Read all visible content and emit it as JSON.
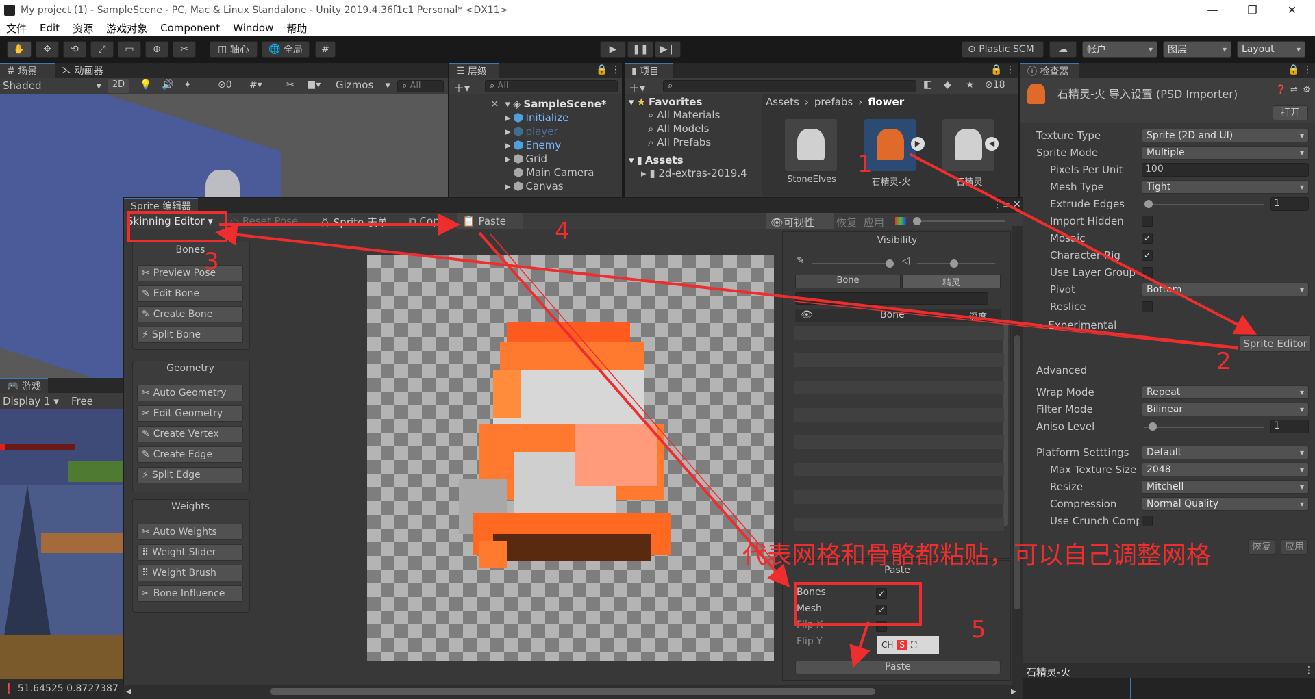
{
  "window": {
    "title": "My project (1) - SampleScene - PC, Mac & Linux Standalone - Unity 2019.4.36f1c1 Personal* <DX11>"
  },
  "menu": [
    "文件",
    "Edit",
    "资源",
    "游戏对象",
    "Component",
    "Window",
    "帮助"
  ],
  "toolbar": {
    "pivot_label": "轴心",
    "global_label": "全局",
    "plastic_label": "Plastic SCM",
    "account_label": "帐户",
    "layers_label": "图层",
    "layout_label": "Layout"
  },
  "scene": {
    "tab_scene": "场景",
    "tab_animator": "动画器",
    "shading": "Shaded",
    "mode_2d": "2D",
    "hidden_count": "0",
    "gizmos": "Gizmos",
    "search_placeholder": "All"
  },
  "game": {
    "tab": "游戏",
    "display": "Display 1",
    "aspect": "Free Aspect",
    "coords": "51.64525 0.8727387"
  },
  "hierarchy": {
    "tab": "层级",
    "search_placeholder": "All",
    "scene_name": "SampleScene*",
    "items": [
      "Initialize",
      "player",
      "Enemy",
      "Grid",
      "Main Camera",
      "Canvas"
    ]
  },
  "project": {
    "tab": "项目",
    "hidden_count": "18",
    "favorites_label": "Favorites",
    "favorites": [
      "All Materials",
      "All Models",
      "All Prefabs"
    ],
    "assets_label": "Assets",
    "asset_items": [
      "2d-extras-2019.4"
    ],
    "breadcrumb": [
      "Assets",
      "prefabs",
      "flower"
    ],
    "thumbs": [
      "StoneElves",
      "石精灵-火",
      "石精灵"
    ]
  },
  "inspector": {
    "tab": "检查器",
    "asset_title": "石精灵-火 导入设置 (PSD Importer)",
    "open_button": "打开",
    "fields": {
      "texture_type": {
        "label": "Texture Type",
        "value": "Sprite (2D and UI)"
      },
      "sprite_mode": {
        "label": "Sprite Mode",
        "value": "Multiple"
      },
      "ppu": {
        "label": "Pixels Per Unit",
        "value": "100"
      },
      "mesh_type": {
        "label": "Mesh Type",
        "value": "Tight"
      },
      "extrude": {
        "label": "Extrude Edges",
        "value": "1"
      },
      "import_hidden": {
        "label": "Import Hidden"
      },
      "mosaic": {
        "label": "Mosaic"
      },
      "character_rig": {
        "label": "Character Rig"
      },
      "use_layer_group": {
        "label": "Use Layer Group"
      },
      "pivot": {
        "label": "Pivot",
        "value": "Bottom"
      },
      "reslice": {
        "label": "Reslice"
      },
      "experimental": {
        "label": "Experimental"
      }
    },
    "sprite_editor_button": "Sprite Editor",
    "advanced_label": "Advanced",
    "wrap_mode": {
      "label": "Wrap Mode",
      "value": "Repeat"
    },
    "filter_mode": {
      "label": "Filter Mode",
      "value": "Bilinear"
    },
    "aniso": {
      "label": "Aniso Level",
      "value": "1"
    },
    "platform_label": "Platform Setttings",
    "platform_value": "Default",
    "max_size": {
      "label": "Max Texture Size",
      "value": "2048"
    },
    "resize": {
      "label": "Resize",
      "value": "Mitchell"
    },
    "compression": {
      "label": "Compression",
      "value": "Normal Quality"
    },
    "crunch": {
      "label": "Use Crunch Compression"
    },
    "revert_button": "恢复",
    "apply_button": "应用",
    "preview_title": "石精灵-火"
  },
  "sprite_editor": {
    "title": "Sprite 编辑器",
    "mode_dropdown": "Skinning Editor",
    "reset_pose": "Reset Pose",
    "sprite_list": "Sprite 表单",
    "copy": "Copy",
    "paste": "Paste",
    "visibility_toggle": "可视性",
    "revert": "恢复",
    "apply": "应用",
    "groups": {
      "bones": {
        "title": "Bones",
        "buttons": [
          "Preview Pose",
          "Edit Bone",
          "Create Bone",
          "Split Bone"
        ]
      },
      "geometry": {
        "title": "Geometry",
        "buttons": [
          "Auto Geometry",
          "Edit Geometry",
          "Create Vertex",
          "Create Edge",
          "Split Edge"
        ]
      },
      "weights": {
        "title": "Weights",
        "buttons": [
          "Auto Weights",
          "Weight Slider",
          "Weight Brush",
          "Bone Influence"
        ]
      }
    },
    "visibility": {
      "title": "Visibility",
      "tab_bone": "Bone",
      "tab_sprite": "精灵",
      "col_bone": "Bone",
      "col_depth": "深度"
    },
    "paste_panel": {
      "title": "Paste",
      "bones": "Bones",
      "mesh": "Mesh",
      "flip_x": "Flip X",
      "flip_y": "Flip Y",
      "button": "Paste"
    }
  },
  "annotations": {
    "n1": "1",
    "n2": "2",
    "n3": "3",
    "n4": "4",
    "n5": "5",
    "note": "代表网格和骨骼都粘贴，可以自己调整网格",
    "color": "#ee2e2e"
  },
  "ime": {
    "label": "CH"
  }
}
